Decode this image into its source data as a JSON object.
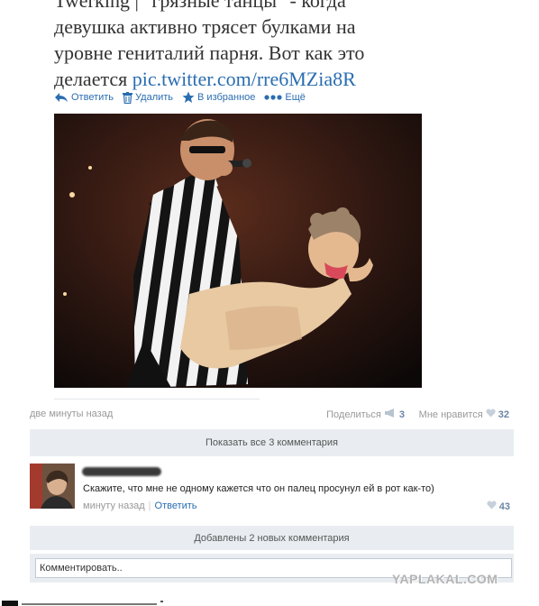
{
  "post": {
    "text_lines": [
      "Twerking | \"грязные танцы\" - когда",
      "девушка активно трясет булками на",
      "уровне гениталий парня. Вот как это",
      "делается "
    ],
    "link": "pic.twitter.com/rre6MZia8R"
  },
  "actions": {
    "reply": "Ответить",
    "delete": "Удалить",
    "favorite": "В избранное",
    "more": "Ещё"
  },
  "meta": {
    "time": "две минуты назад",
    "share_label": "Поделиться",
    "share_count": "3",
    "like_label": "Мне нравится",
    "like_count": "32"
  },
  "show_all_comments": "Показать все 3 комментария",
  "comment": {
    "text": "Скажите, что мне не одному кажется что он палец просунул ей в рот как-то)",
    "time": "минуту назад",
    "reply": "Ответить",
    "like_count": "43"
  },
  "new_comments": "Добавлены 2 новых комментария",
  "comment_input": {
    "placeholder": "Комментировать.."
  },
  "watermark": "YAPLAKAL.COM",
  "colors": {
    "link": "#2a6db0",
    "bar_bg": "#e9edf1",
    "count": "#6a86a6"
  }
}
